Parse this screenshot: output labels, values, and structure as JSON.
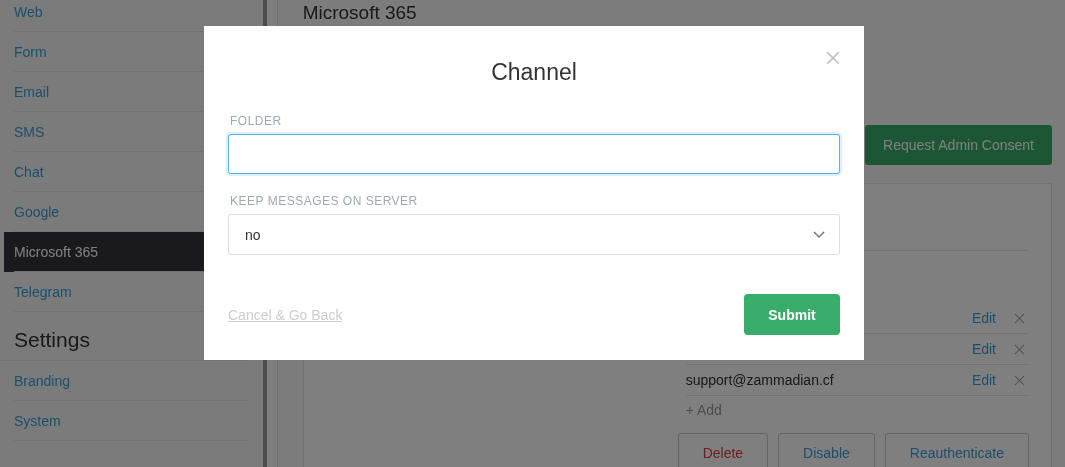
{
  "sidebar": {
    "items": [
      {
        "label": "Web",
        "selected": false
      },
      {
        "label": "Form",
        "selected": false
      },
      {
        "label": "Email",
        "selected": false
      },
      {
        "label": "SMS",
        "selected": false
      },
      {
        "label": "Chat",
        "selected": false
      },
      {
        "label": "Google",
        "selected": false
      },
      {
        "label": "Microsoft 365",
        "selected": true
      },
      {
        "label": "Telegram",
        "selected": false
      }
    ],
    "section_title": "Settings",
    "settings_items": [
      {
        "label": "Branding",
        "selected": false
      },
      {
        "label": "System",
        "selected": false
      }
    ]
  },
  "main": {
    "title": "Microsoft 365",
    "consent_button": "Request Admin Consent",
    "rows": [
      {
        "action": "Edit"
      },
      {
        "action": "Edit"
      },
      {
        "email": "support@zammadian.cf",
        "action": "Edit"
      }
    ],
    "add_link": "+ Add",
    "buttons": [
      {
        "label": "Delete",
        "kind": "danger"
      },
      {
        "label": "Disable",
        "kind": "default"
      },
      {
        "label": "Reauthenticate",
        "kind": "default"
      }
    ]
  },
  "modal": {
    "title": "Channel",
    "fields": [
      {
        "kind": "text",
        "label": "FOLDER",
        "focused": true
      },
      {
        "kind": "select",
        "label": "KEEP MESSAGES ON SERVER",
        "value": "no",
        "focused": false
      }
    ],
    "cancel": "Cancel & Go Back",
    "submit": "Submit"
  }
}
